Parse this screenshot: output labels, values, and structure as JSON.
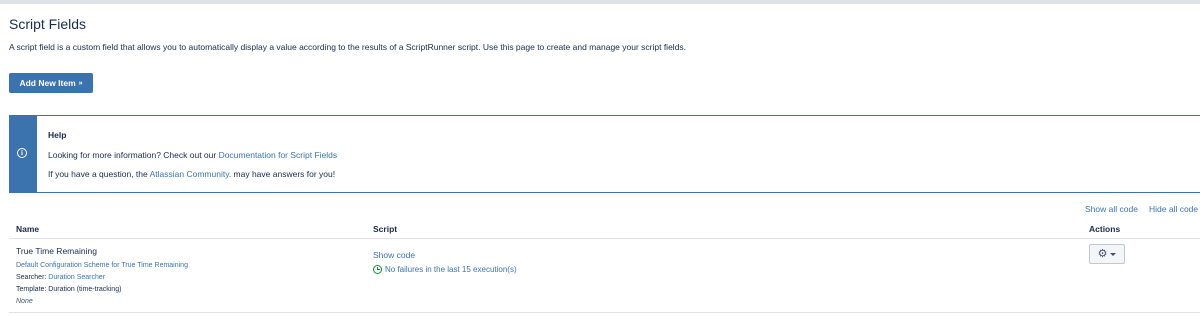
{
  "page": {
    "title": "Script Fields",
    "description": "A script field is a custom field that allows you to automatically display a value according to the results of a ScriptRunner script. Use this page to create and manage your script fields."
  },
  "toolbar": {
    "add_label": "Add New Item",
    "add_chevron": "»"
  },
  "help": {
    "title": "Help",
    "line1_prefix": "Looking for more information? Check out our ",
    "line1_link": "Documentation for Script Fields",
    "line2_prefix": "If you have a question, the ",
    "line2_link": "Atlassian Community",
    "line2_suffix": ". may have answers for you!",
    "icon": "info-icon"
  },
  "table": {
    "show_all": "Show all code",
    "hide_all": "Hide all code",
    "headers": {
      "name": "Name",
      "script": "Script",
      "actions": "Actions"
    },
    "rows": [
      {
        "name": "True Time Remaining",
        "scheme": "Default Configuration Scheme for True Time Remaining",
        "searcher_label": "Searcher: ",
        "searcher_value": "Duration Searcher",
        "template": "Template: Duration (time-tracking)",
        "context": "None",
        "show_code": "Show code",
        "status": "No failures in the last 15 execution(s)",
        "status_icon": "clock-icon",
        "actions_icon": "gear-icon"
      }
    ]
  },
  "colors": {
    "accent": "#3b73af",
    "success": "#14892c",
    "text": "#172b4d"
  }
}
